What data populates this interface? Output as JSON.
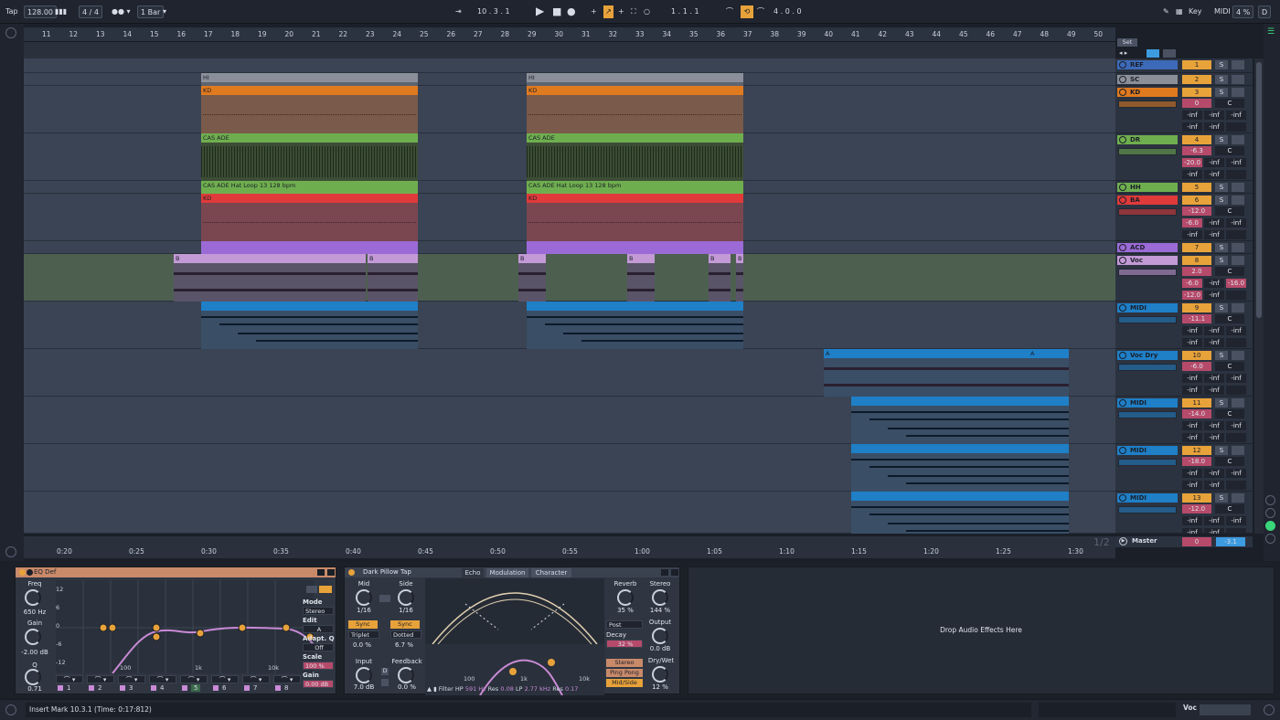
{
  "control_bar": {
    "tap": "Tap",
    "tempo": "128.00",
    "signature": "4 / 4",
    "quantize": "1 Bar",
    "position": "10 .   3 .   1",
    "loop_start": "1 .   1 .   1",
    "loop_length": "4 .   0 .   0",
    "key": "Key",
    "midi": "MIDI",
    "cpu": "4 %",
    "d": "D"
  },
  "ruler": {
    "bars": [
      "11",
      "12",
      "13",
      "14",
      "15",
      "16",
      "17",
      "18",
      "19",
      "20",
      "21",
      "22",
      "23",
      "24",
      "25",
      "26",
      "27",
      "28",
      "29",
      "30",
      "31",
      "32",
      "33",
      "34",
      "35",
      "36",
      "37",
      "38",
      "39",
      "40",
      "41",
      "42",
      "43",
      "44",
      "45",
      "46",
      "47",
      "48",
      "49",
      "50"
    ],
    "times": [
      "0:20",
      "0:25",
      "0:30",
      "0:35",
      "0:40",
      "0:45",
      "0:50",
      "0:55",
      "1:00",
      "1:05",
      "1:10",
      "1:15",
      "1:20",
      "1:25",
      "1:30"
    ],
    "set_label": "Set",
    "page": "1/2"
  },
  "clips": {
    "hi": "HI",
    "kd": "KD",
    "dr": "CAS ADE",
    "hh": "CAS ADE Hat Loop 13 128 bpm",
    "b": "B",
    "a": "A"
  },
  "tracks": [
    {
      "name": "REF",
      "num": "1",
      "color": "#3d6ab8",
      "vol": "",
      "pan": "",
      "s1": "",
      "s2": ""
    },
    {
      "name": "SC",
      "num": "2",
      "color": "#8a8f99",
      "vol": "",
      "pan": "",
      "s1": "",
      "s2": ""
    },
    {
      "name": "KD",
      "num": "3",
      "color": "#e07a1f",
      "vol": "0",
      "pan": "C",
      "s1": "-inf",
      "s2": "-inf",
      "s3": "-inf",
      "s4": "-inf",
      "s5": "-inf"
    },
    {
      "name": "DR",
      "num": "4",
      "color": "#6fae4f",
      "vol": "-6.3",
      "pan": "C",
      "s1": "-20.0",
      "s2": "-inf",
      "s3": "-inf",
      "s4": "-inf",
      "s5": "-inf"
    },
    {
      "name": "HH",
      "num": "5",
      "color": "#6fae4f",
      "vol": "",
      "pan": "",
      "s1": "",
      "s2": ""
    },
    {
      "name": "BA",
      "num": "6",
      "color": "#e03a3a",
      "vol": "-12.0",
      "pan": "C",
      "s1": "-6.0",
      "s2": "-inf",
      "s3": "-inf",
      "s4": "-inf",
      "s5": "-inf"
    },
    {
      "name": "ACD",
      "num": "7",
      "color": "#9b6ad6",
      "vol": "",
      "pan": "",
      "s1": "",
      "s2": ""
    },
    {
      "name": "Voc",
      "num": "8",
      "color": "#c39ad6",
      "vol": "2.0",
      "pan": "C",
      "s1": "-6.0",
      "s2": "-inf",
      "s3": "-16.0",
      "s4": "-12.0",
      "s5": "-inf"
    },
    {
      "name": "MIDI",
      "num": "9",
      "color": "#1f7fc7",
      "vol": "-11.1",
      "pan": "C",
      "s1": "-inf",
      "s2": "-inf",
      "s3": "-inf",
      "s4": "-inf",
      "s5": "-inf"
    },
    {
      "name": "Voc Dry",
      "num": "10",
      "color": "#1f7fc7",
      "vol": "-6.0",
      "pan": "C",
      "s1": "-inf",
      "s2": "-inf",
      "s3": "-inf",
      "s4": "-inf",
      "s5": "-inf"
    },
    {
      "name": "MIDI",
      "num": "11",
      "color": "#1f7fc7",
      "vol": "-14.0",
      "pan": "C",
      "s1": "-inf",
      "s2": "-inf",
      "s3": "-inf",
      "s4": "-inf",
      "s5": "-inf"
    },
    {
      "name": "MIDI",
      "num": "12",
      "color": "#1f7fc7",
      "vol": "-18.0",
      "pan": "C",
      "s1": "-inf",
      "s2": "-inf",
      "s3": "-inf",
      "s4": "-inf",
      "s5": "-inf"
    },
    {
      "name": "MIDI",
      "num": "13",
      "color": "#1f7fc7",
      "vol": "-12.0",
      "pan": "C",
      "s1": "-inf",
      "s2": "-inf",
      "s3": "-inf",
      "s4": "-inf",
      "s5": "-inf"
    }
  ],
  "master": {
    "name": "Master",
    "vol": "0",
    "peak": "-3.1"
  },
  "s_label": "S",
  "eq": {
    "title": "EQ Def",
    "freq_label": "Freq",
    "freq": "650 Hz",
    "gain_label": "Gain",
    "gain": "-2.00 dB",
    "q_label": "Q",
    "q": "0.71",
    "mode_label": "Mode",
    "mode": "Stereo",
    "edit_label": "Edit",
    "edit": "A",
    "adapt_label": "Adapt. Q",
    "adapt": "Off",
    "scale_label": "Scale",
    "scale": "100 %",
    "gain2_label": "Gain",
    "gain2": "0.00 dB",
    "db_ticks": [
      "12",
      "6",
      "0",
      "-6",
      "-12"
    ],
    "freq_ticks": [
      "100",
      "1k",
      "10k"
    ],
    "bands": [
      "1",
      "2",
      "3",
      "4",
      "5",
      "6",
      "7",
      "8"
    ]
  },
  "echo": {
    "title": "Dark Pillow Tap",
    "tabs": [
      "Echo",
      "Modulation",
      "Character"
    ],
    "mid_label": "Mid",
    "mid": "1/16",
    "side_label": "Side",
    "side": "1/16",
    "sync": "Sync",
    "triplet": "Triplet",
    "dotted": "Dotted",
    "offset_l": "0.0 %",
    "offset_r": "6.7 %",
    "input_label": "Input",
    "input": "7.0 dB",
    "feedback_label": "Feedback",
    "feedback": "0.0 %",
    "reverb_label": "Reverb",
    "reverb": "35 %",
    "stereo_label": "Stereo",
    "stereo": "144 %",
    "post": "Post",
    "output_label": "Output",
    "output": "0.0 dB",
    "decay_label": "Decay",
    "decay": "32 %",
    "drywet_label": "Dry/Wet",
    "drywet": "12 %",
    "stereo_btn": "Stereo",
    "pingpong": "Ping Pong",
    "midside": "Mid/Side",
    "filter": "Filter",
    "hp": "HP",
    "hp_val": "591 Hz",
    "res": "Res",
    "res1": "0.08",
    "lp": "LP",
    "lp_val": "2.77 kHz",
    "res2": "0.17",
    "freq_ticks": [
      "100",
      "1k",
      "10k"
    ],
    "d_btn": "D"
  },
  "drop_zone": "Drop Audio Effects Here",
  "status": {
    "text": "Insert Mark 10.3.1 (Time: 0:17:812)",
    "track": "Voc"
  }
}
